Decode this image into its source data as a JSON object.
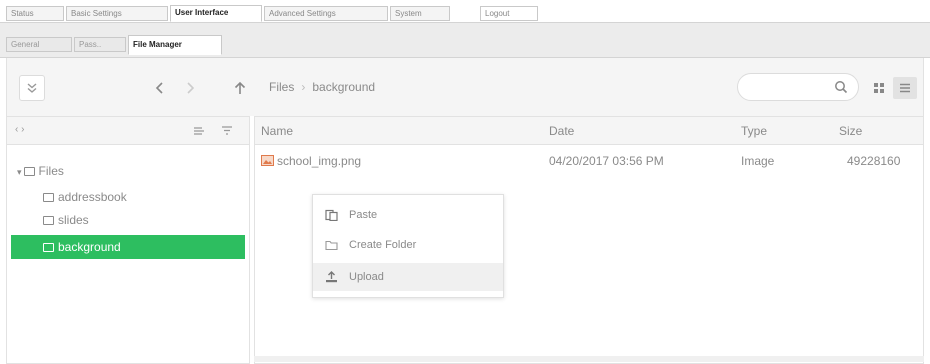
{
  "top_tabs": [
    {
      "label": "Status"
    },
    {
      "label": "Basic Settings"
    },
    {
      "label": "User Interface",
      "active": true
    },
    {
      "label": "Advanced Settings"
    },
    {
      "label": "System"
    }
  ],
  "logout_label": "Logout",
  "sub_tabs": [
    {
      "label": "General"
    },
    {
      "label": "Pass.."
    },
    {
      "label": "File Manager",
      "active": true
    }
  ],
  "toolbar": {
    "collapse_icon": "double-chevron-down-icon",
    "back_icon": "chevron-left-icon",
    "forward_icon": "chevron-right-icon",
    "up_icon": "arrow-up-icon",
    "search_placeholder": "",
    "grid_view_icon": "grid-icon",
    "list_view_icon": "list-icon"
  },
  "breadcrumb": [
    "Files",
    "background"
  ],
  "left_panel": {
    "sort_label": "‹ ›",
    "tree_root": "Files",
    "tree_children": [
      {
        "label": "addressbook"
      },
      {
        "label": "slides"
      },
      {
        "label": "background",
        "selected": true
      }
    ]
  },
  "table": {
    "columns": [
      "Name",
      "Date",
      "Type",
      "Size"
    ],
    "rows": [
      {
        "name": "school_img.png",
        "date": "04/20/2017 03:56 PM",
        "type": "Image",
        "size": "49228160"
      }
    ]
  },
  "context_menu": [
    {
      "label": "Paste",
      "icon": "paste-icon"
    },
    {
      "label": "Create Folder",
      "icon": "folder-icon"
    },
    {
      "label": "Upload",
      "icon": "upload-icon",
      "hover": true
    }
  ],
  "colors": {
    "accent": "#2dbe60",
    "border": "#e2e2e2",
    "text": "#8a8a8a"
  }
}
